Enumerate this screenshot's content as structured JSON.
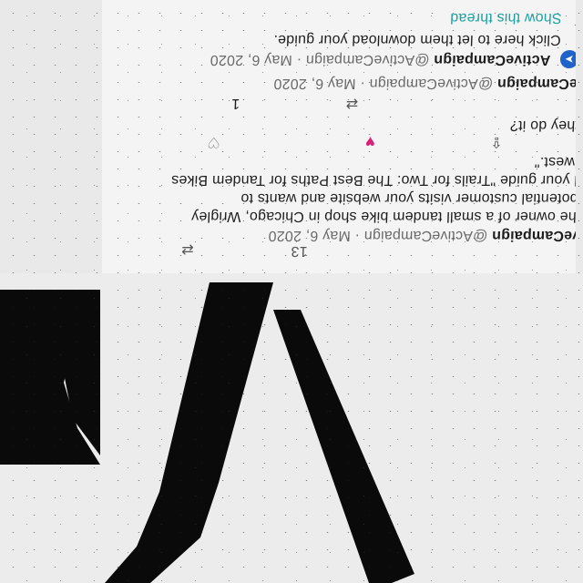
{
  "thread_link": "Show this thread",
  "tweet_top": {
    "text": "Click here to let them download your guide.",
    "name": "ActiveCampaign",
    "handle": "@ActiveCampaign",
    "date": "· May 6, 2020"
  },
  "tweet_mid": {
    "name": "ActiveCampaign",
    "handle": "@ActiveCampaign",
    "date": "· May 6, 2020",
    "text": "n do they do it?",
    "reply_count": "1"
  },
  "tweet_main": {
    "name": "ActiveCampaign",
    "handle": "@ActiveCampaign",
    "date": "· May 6, 2020",
    "line1": "u're the owner of a small tandem bike shop in Chicago, Wrigley",
    "line2": "ls. A potential customer visits your website and wants to",
    "line3": "nload your guide \"Trails for Two: The Best Paths for Tandem Bikes",
    "line4": "e Midwest.\"",
    "retweet_count": "13"
  },
  "colors": {
    "accent": "#1da1a2",
    "heart": "#d3237a",
    "avatar": "#1f62c9"
  },
  "icons": [
    "share-icon",
    "retweet-icon",
    "heart-icon",
    "reply-icon"
  ]
}
